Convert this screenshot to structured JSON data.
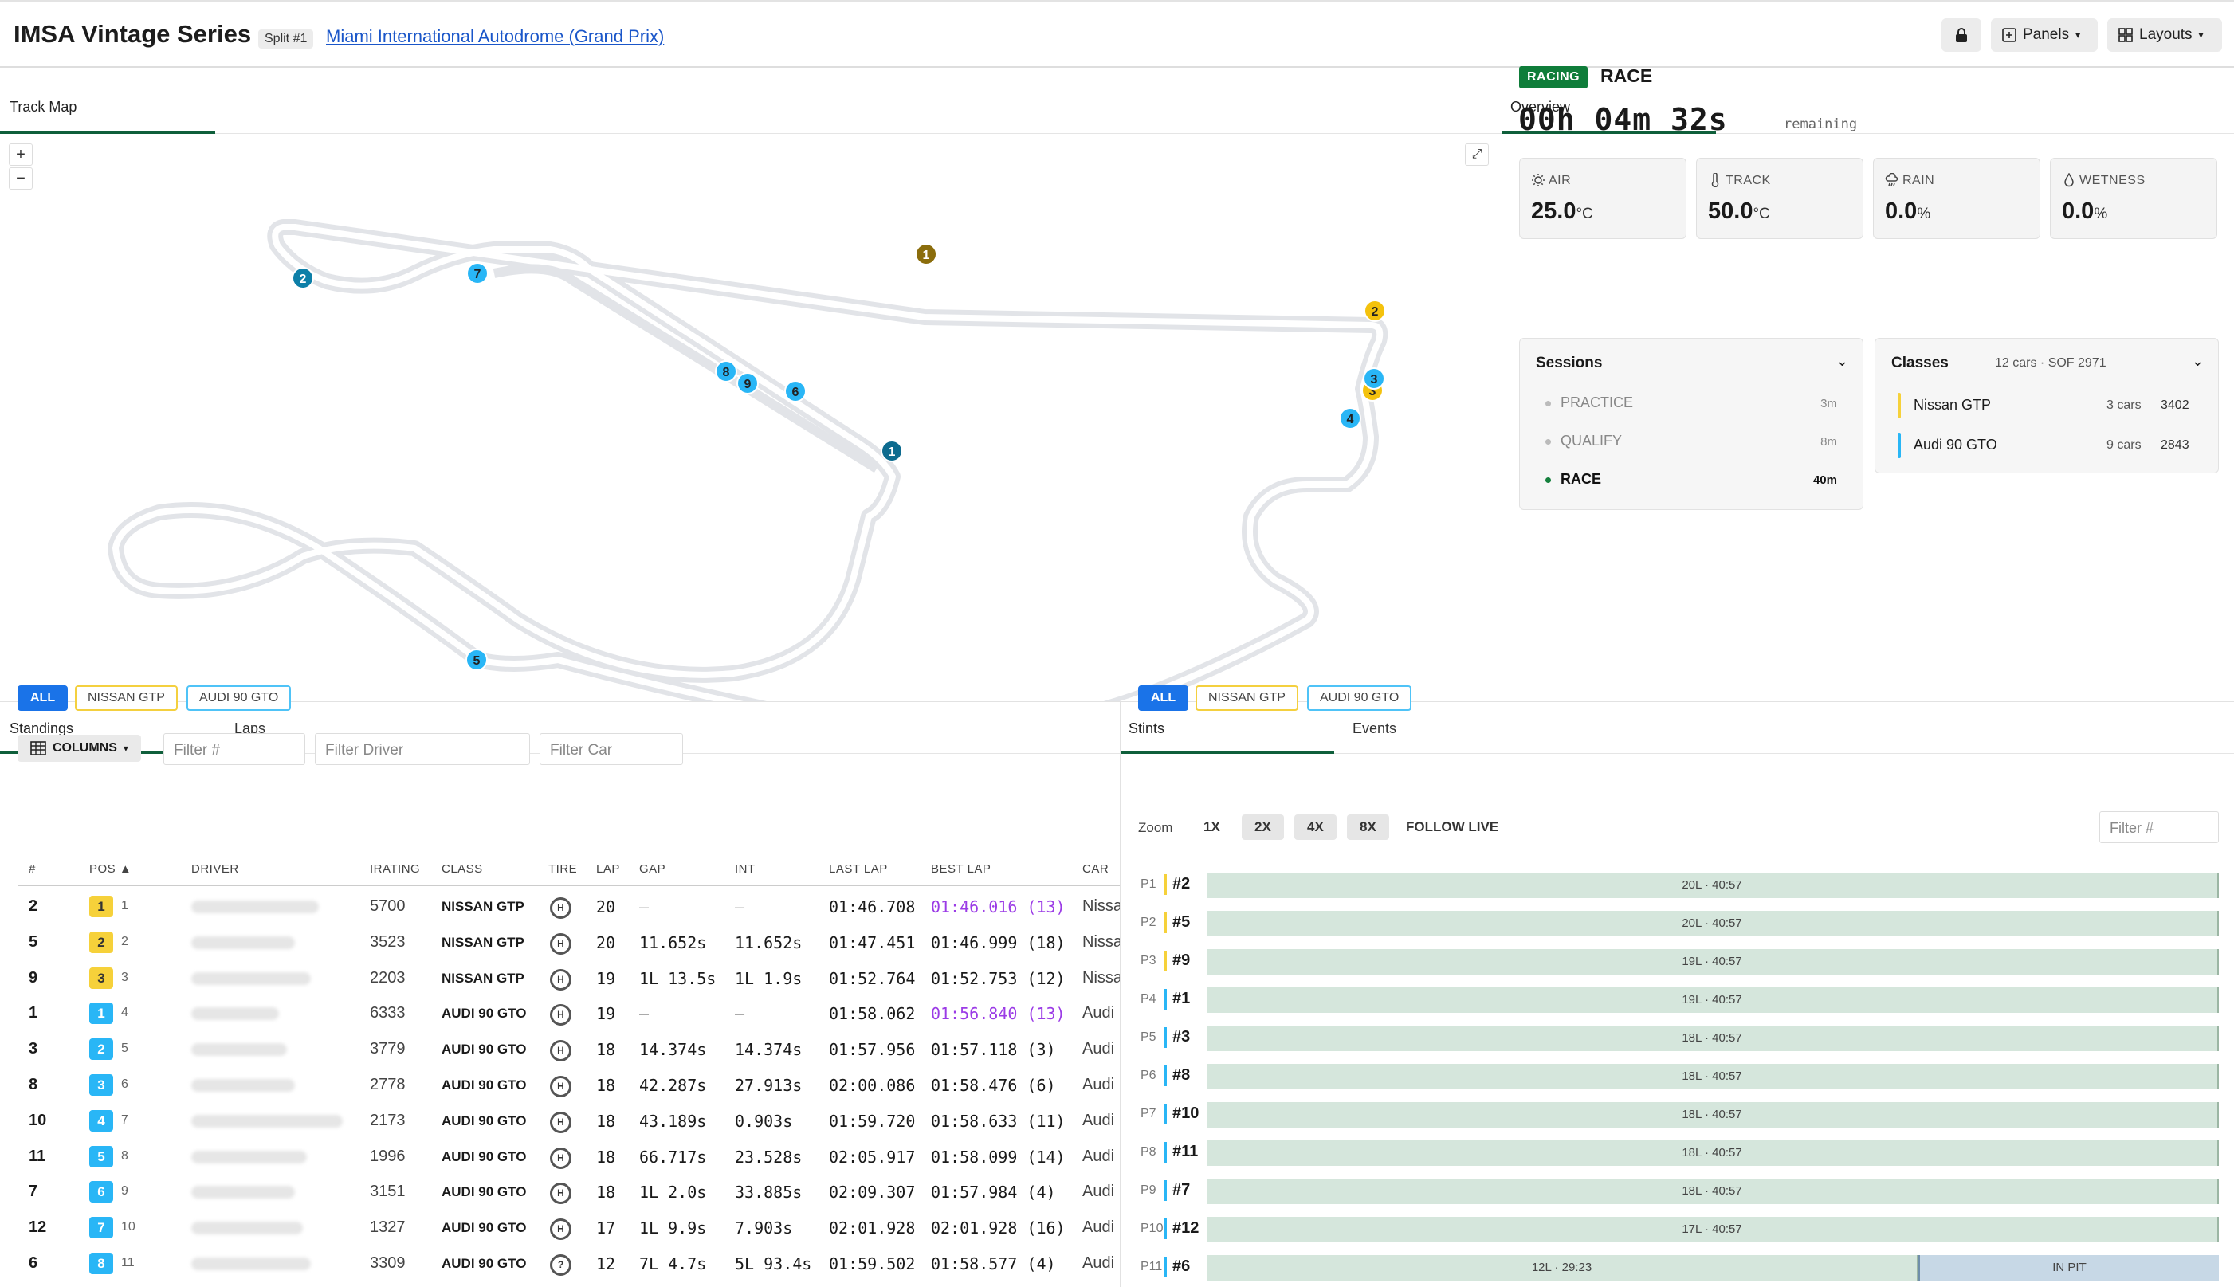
{
  "header": {
    "title": "IMSA Vintage Series",
    "split": "Split #1",
    "track": "Miami International Autodrome (Grand Prix)",
    "panels_label": "Panels",
    "layouts_label": "Layouts"
  },
  "map": {
    "tab": "Track Map",
    "zoom_in": "+",
    "zoom_out": "−"
  },
  "overview": {
    "tab": "Overview",
    "status": "RACING",
    "session": "RACE",
    "countdown": "00h 04m 32s",
    "remaining": "remaining",
    "weather": [
      {
        "label": "AIR",
        "value": "25.0",
        "unit": "°C",
        "icon": "sun-icon"
      },
      {
        "label": "TRACK",
        "value": "50.0",
        "unit": "°C",
        "icon": "thermometer-icon"
      },
      {
        "label": "RAIN",
        "value": "0.0",
        "unit": "%",
        "icon": "cloud-rain-icon"
      },
      {
        "label": "WETNESS",
        "value": "0.0",
        "unit": "%",
        "icon": "droplet-icon"
      }
    ],
    "sessions": {
      "title": "Sessions",
      "items": [
        {
          "name": "PRACTICE",
          "duration": "3m"
        },
        {
          "name": "QUALIFY",
          "duration": "8m"
        },
        {
          "name": "RACE",
          "duration": "40m"
        }
      ]
    },
    "classes": {
      "title": "Classes",
      "summary": "12 cars · SOF 2971",
      "items": [
        {
          "name": "Nissan GTP",
          "cars": "3 cars",
          "sof": "3402",
          "color": "#f6d13a"
        },
        {
          "name": "Audi 90 GTO",
          "cars": "9 cars",
          "sof": "2843",
          "color": "#29b6f6"
        }
      ]
    }
  },
  "standings": {
    "tabs": [
      "Standings",
      "Laps"
    ],
    "filters": [
      "ALL",
      "NISSAN GTP",
      "AUDI 90 GTO"
    ],
    "columns_label": "COLUMNS",
    "inputs": [
      "Filter #",
      "Filter Driver",
      "Filter Car"
    ],
    "headers": [
      "#",
      "POS",
      "DRIVER",
      "IRATING",
      "CLASS",
      "TIRE",
      "LAP",
      "GAP",
      "INT",
      "LAST LAP",
      "BEST LAP",
      "CAR"
    ],
    "rows": [
      {
        "num": "2",
        "cpos": "1",
        "opos": "1",
        "irating": "5700",
        "cls": "NISSAN GTP",
        "tire": "H",
        "lap": "20",
        "gap": "—",
        "int": "—",
        "last": "01:46.708",
        "best": "01:46.016 (13)",
        "best_fast": true,
        "car": "Nissa"
      },
      {
        "num": "5",
        "cpos": "2",
        "opos": "2",
        "irating": "3523",
        "cls": "NISSAN GTP",
        "tire": "H",
        "lap": "20",
        "gap": "11.652s",
        "int": "11.652s",
        "last": "01:47.451",
        "best": "01:46.999 (18)",
        "best_fast": false,
        "car": "Nissa"
      },
      {
        "num": "9",
        "cpos": "3",
        "opos": "3",
        "irating": "2203",
        "cls": "NISSAN GTP",
        "tire": "H",
        "lap": "19",
        "gap": "1L 13.5s",
        "int": "1L 1.9s",
        "last": "01:52.764",
        "best": "01:52.753 (12)",
        "best_fast": false,
        "car": "Nissa"
      },
      {
        "num": "1",
        "cpos": "1",
        "opos": "4",
        "irating": "6333",
        "cls": "AUDI 90 GTO",
        "tire": "H",
        "lap": "19",
        "gap": "—",
        "int": "—",
        "last": "01:58.062",
        "best": "01:56.840 (13)",
        "best_fast": true,
        "car": "Audi"
      },
      {
        "num": "3",
        "cpos": "2",
        "opos": "5",
        "irating": "3779",
        "cls": "AUDI 90 GTO",
        "tire": "H",
        "lap": "18",
        "gap": "14.374s",
        "int": "14.374s",
        "last": "01:57.956",
        "best": "01:57.118 (3)",
        "best_fast": false,
        "car": "Audi"
      },
      {
        "num": "8",
        "cpos": "3",
        "opos": "6",
        "irating": "2778",
        "cls": "AUDI 90 GTO",
        "tire": "H",
        "lap": "18",
        "gap": "42.287s",
        "int": "27.913s",
        "last": "02:00.086",
        "best": "01:58.476 (6)",
        "best_fast": false,
        "car": "Audi"
      },
      {
        "num": "10",
        "cpos": "4",
        "opos": "7",
        "irating": "2173",
        "cls": "AUDI 90 GTO",
        "tire": "H",
        "lap": "18",
        "gap": "43.189s",
        "int": "0.903s",
        "last": "01:59.720",
        "best": "01:58.633 (11)",
        "best_fast": false,
        "car": "Audi"
      },
      {
        "num": "11",
        "cpos": "5",
        "opos": "8",
        "irating": "1996",
        "cls": "AUDI 90 GTO",
        "tire": "H",
        "lap": "18",
        "gap": "66.717s",
        "int": "23.528s",
        "last": "02:05.917",
        "best": "01:58.099 (14)",
        "best_fast": false,
        "car": "Audi"
      },
      {
        "num": "7",
        "cpos": "6",
        "opos": "9",
        "irating": "3151",
        "cls": "AUDI 90 GTO",
        "tire": "H",
        "lap": "18",
        "gap": "1L 2.0s",
        "int": "33.885s",
        "last": "02:09.307",
        "best": "01:57.984 (4)",
        "best_fast": false,
        "car": "Audi"
      },
      {
        "num": "12",
        "cpos": "7",
        "opos": "10",
        "irating": "1327",
        "cls": "AUDI 90 GTO",
        "tire": "H",
        "lap": "17",
        "gap": "1L 9.9s",
        "int": "7.903s",
        "last": "02:01.928",
        "best": "02:01.928 (16)",
        "best_fast": false,
        "car": "Audi"
      },
      {
        "num": "6",
        "cpos": "8",
        "opos": "11",
        "irating": "3309",
        "cls": "AUDI 90 GTO",
        "tire": "?",
        "lap": "12",
        "gap": "7L 4.7s",
        "int": "5L 93.4s",
        "last": "01:59.502",
        "best": "01:58.577 (4)",
        "best_fast": false,
        "car": "Audi"
      }
    ]
  },
  "stints": {
    "tabs": [
      "Stints",
      "Events"
    ],
    "filters": [
      "ALL",
      "NISSAN GTP",
      "AUDI 90 GTO"
    ],
    "zoom_label": "Zoom",
    "zooms": [
      "1X",
      "2X",
      "4X",
      "8X"
    ],
    "follow": "FOLLOW LIVE",
    "filter_placeholder": "Filter #",
    "rows": [
      {
        "pos": "P1",
        "car": "#2",
        "cls": "gtp",
        "stints": [
          {
            "label": "20L · 40:57",
            "frac": 1.0,
            "pit": false
          }
        ]
      },
      {
        "pos": "P2",
        "car": "#5",
        "cls": "gtp",
        "stints": [
          {
            "label": "20L · 40:57",
            "frac": 1.0,
            "pit": false
          }
        ]
      },
      {
        "pos": "P3",
        "car": "#9",
        "cls": "gtp",
        "stints": [
          {
            "label": "19L · 40:57",
            "frac": 1.0,
            "pit": false
          }
        ]
      },
      {
        "pos": "P4",
        "car": "#1",
        "cls": "gto",
        "stints": [
          {
            "label": "19L · 40:57",
            "frac": 1.0,
            "pit": false
          }
        ]
      },
      {
        "pos": "P5",
        "car": "#3",
        "cls": "gto",
        "stints": [
          {
            "label": "18L · 40:57",
            "frac": 1.0,
            "pit": false
          }
        ]
      },
      {
        "pos": "P6",
        "car": "#8",
        "cls": "gto",
        "stints": [
          {
            "label": "18L · 40:57",
            "frac": 1.0,
            "pit": false
          }
        ]
      },
      {
        "pos": "P7",
        "car": "#10",
        "cls": "gto",
        "stints": [
          {
            "label": "18L · 40:57",
            "frac": 1.0,
            "pit": false
          }
        ]
      },
      {
        "pos": "P8",
        "car": "#11",
        "cls": "gto",
        "stints": [
          {
            "label": "18L · 40:57",
            "frac": 1.0,
            "pit": false
          }
        ]
      },
      {
        "pos": "P9",
        "car": "#7",
        "cls": "gto",
        "stints": [
          {
            "label": "18L · 40:57",
            "frac": 1.0,
            "pit": false
          }
        ]
      },
      {
        "pos": "P10",
        "car": "#12",
        "cls": "gto",
        "stints": [
          {
            "label": "17L · 40:57",
            "frac": 1.0,
            "pit": false
          }
        ]
      },
      {
        "pos": "P11",
        "car": "#6",
        "cls": "gto",
        "stints": [
          {
            "label": "12L · 29:23",
            "frac": 0.703,
            "pit": false
          },
          {
            "label": "IN PIT",
            "frac": 0.297,
            "pit": true
          }
        ]
      }
    ]
  },
  "car_markers": [
    {
      "num": "1",
      "color": "#8b6d0c"
    },
    {
      "num": "2",
      "color": "#f4c20d"
    },
    {
      "num": "3",
      "color": "#f4c20d"
    },
    {
      "num": "2",
      "color": "#0d7fa8"
    },
    {
      "num": "7",
      "color": "#29b6f6"
    },
    {
      "num": "8",
      "color": "#29b6f6"
    },
    {
      "num": "9",
      "color": "#29b6f6"
    },
    {
      "num": "6",
      "color": "#29b6f6"
    },
    {
      "num": "1",
      "color": "#0d6b8f"
    },
    {
      "num": "4",
      "color": "#29b6f6"
    },
    {
      "num": "5",
      "color": "#29b6f6"
    },
    {
      "num": "3",
      "color": "#29b6f6"
    }
  ]
}
